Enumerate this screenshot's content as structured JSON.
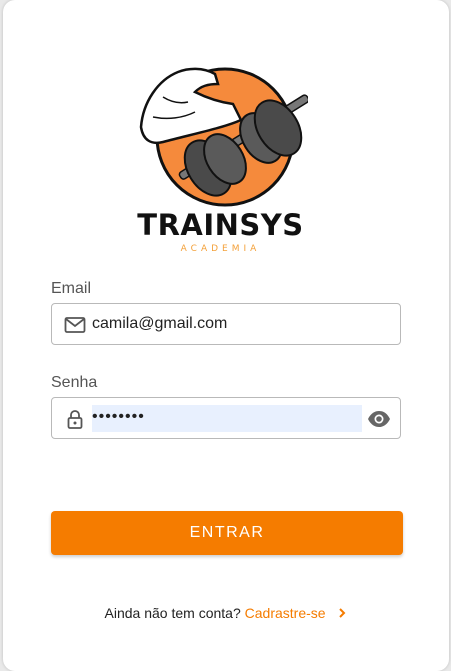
{
  "brand": {
    "name": "TRAINSYS",
    "subtitle": "ACADEMIA"
  },
  "form": {
    "email_label": "Email",
    "email_value": "camila@gmail.com",
    "password_label": "Senha",
    "password_value": "••••••••",
    "submit_label": "ENTRAR"
  },
  "footer": {
    "prompt": "Ainda não tem conta?",
    "link": "Cadrastre-se"
  },
  "icons": {
    "email": "mail-icon",
    "password": "lock-icon",
    "toggle": "eye-icon",
    "link_arrow": "chevron-right-icon"
  },
  "colors": {
    "accent": "#f57c00",
    "autofill": "#e8f0fe"
  }
}
